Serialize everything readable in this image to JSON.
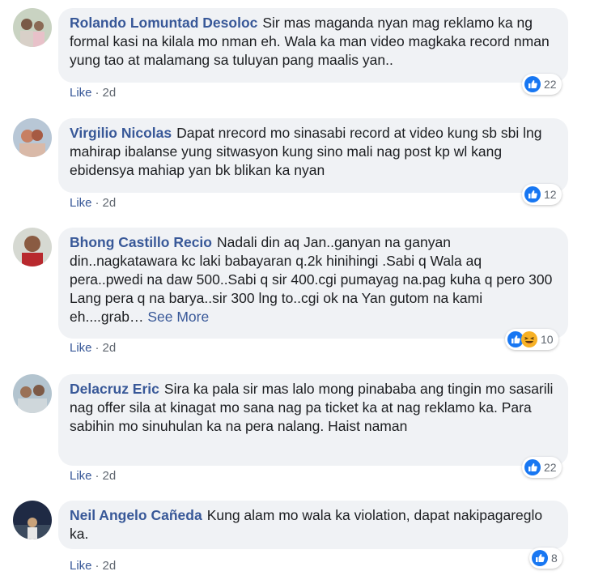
{
  "comments": [
    {
      "author": "Rolando Lomuntad Desoloc",
      "text": "Sir mas maganda nyan mag reklamo ka ng formal kasi na kilala mo nman eh. Wala ka man video magkaka record nman yung tao at malamang sa tuluyan pang maalis yan..",
      "like": "Like",
      "time": "2d",
      "reaction_count": "22",
      "reactions": [
        "like-icon"
      ]
    },
    {
      "author": "Virgilio Nicolas",
      "text": "Dapat nrecord mo sinasabi record at video kung sb sbi lng mahirap ibalanse yung sitwasyon kung sino mali nag post kp wl kang ebidensya mahiap yan bk blikan ka nyan",
      "like": "Like",
      "time": "2d",
      "reaction_count": "12",
      "reactions": [
        "like-icon"
      ]
    },
    {
      "author": "Bhong Castillo Recio",
      "text": "Nadali din aq Jan..ganyan na ganyan din..nagkatawara kc laki babayaran q.2k hinihingi .Sabi q Wala aq pera..pwedi na daw 500..Sabi q sir 400.cgi pumayag na.pag kuha q pero 300 Lang pera q na barya..sir 300 lng to..cgi ok na Yan gutom na kami eh....grab…",
      "see_more": "See More",
      "like": "Like",
      "time": "2d",
      "reaction_count": "10",
      "reactions": [
        "like-icon",
        "haha-icon"
      ]
    },
    {
      "author": "Delacruz Eric",
      "text": "Sira ka pala sir mas lalo mong pinababa ang tingin mo sasarili nag offer sila at kinagat mo sana nag pa ticket ka at nag reklamo ka. Para sabihin mo sinuhulan ka na pera nalang. Haist naman",
      "like": "Like",
      "time": "2d",
      "reaction_count": "22",
      "reactions": [
        "like-icon"
      ]
    },
    {
      "author": "Neil Angelo Cañeda",
      "text": "Kung alam mo wala ka violation, dapat nakipagareglo ka.",
      "like": "Like",
      "time": "2d",
      "reaction_count": "8",
      "reactions": [
        "like-icon"
      ]
    }
  ],
  "colors": {
    "author": "#385898",
    "bubble": "#f0f2f5",
    "meta": "#606770",
    "like_blue": "#1877f2"
  }
}
